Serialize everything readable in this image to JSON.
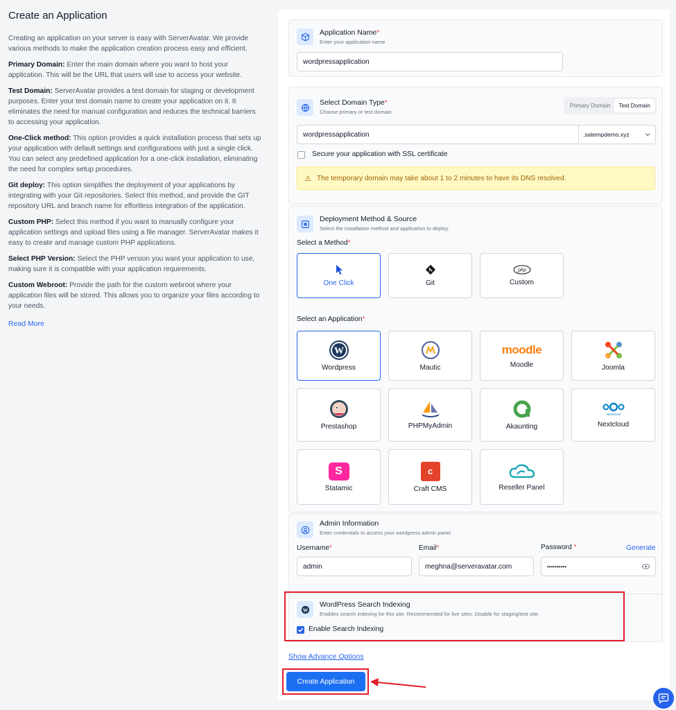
{
  "left": {
    "title": "Create an Application",
    "intro": "Creating an application on your server is easy with ServerAvatar. We provide various methods to make the application creation process easy and efficient.",
    "sections": [
      {
        "term": "Primary Domain:",
        "text": " Enter the main domain where you want to host your application. This will be the URL that users will use to access your website."
      },
      {
        "term": "Test Domain:",
        "text": " ServerAvatar provides a test domain for staging or development purposes. Enter your test domain name to create your application on it. It eliminates the need for manual configuration and reduces the technical barriers to accessing your application."
      },
      {
        "term": "One-Click method:",
        "text": " This option provides a quick installation process that sets up your application with default settings and configurations with just a single click. You can select any predefined application for a one-click installation, eliminating the need for complex setup procedures."
      },
      {
        "term": "Git deploy:",
        "text": " This option simplifies the deployment of your applications by integrating with your Git repositories. Select this method, and provide the GIT repository URL and branch name for effortless integration of the application."
      },
      {
        "term": "Custom PHP:",
        "text": " Select this method if you want to manually configure your application settings and upload files using a file manager. ServerAvatar makes it easy to create and manage custom PHP applications."
      },
      {
        "term": "Select PHP Version:",
        "text": " Select the PHP version you want your application to use, making sure it is compatible with your application requirements."
      },
      {
        "term": "Custom Webroot:",
        "text": " Provide the path for the custom webroot where your application files will be stored. This allows you to organize your files according to your needs."
      }
    ],
    "read_more": "Read More"
  },
  "app_name": {
    "title": "Application Name",
    "required": "*",
    "subtitle": "Enter your application name",
    "value": "wordpressapplication"
  },
  "domain": {
    "title": "Select Domain Type",
    "required": "*",
    "subtitle": "Choose primary or test domain",
    "options": [
      "Primary Domain",
      "Test Domain"
    ],
    "selected": "Test Domain",
    "value": "wordpressapplication",
    "suffix": ".satempdemo.xyz",
    "ssl_label": "Secure your application with SSL certificate",
    "alert": "The temporary domain may take about 1 to 2 minutes to have its DNS resolved."
  },
  "deploy": {
    "title": "Deployment Method & Source",
    "subtitle": "Select the installation method and application to deploy.",
    "method_label": "Select a Method",
    "required": "*",
    "methods": [
      {
        "label": "One Click",
        "icon": "cursor-icon",
        "selected": true
      },
      {
        "label": "Git",
        "icon": "git-icon",
        "selected": false
      },
      {
        "label": "Custom",
        "icon": "php-icon",
        "selected": false
      }
    ],
    "app_label": "Select an Application",
    "apps": [
      {
        "label": "Wordpress",
        "icon": "wordpress-icon",
        "selected": true
      },
      {
        "label": "Mautic",
        "icon": "mautic-icon"
      },
      {
        "label": "Moodle",
        "icon": "moodle-logo",
        "logo_text": "moodle"
      },
      {
        "label": "Joomla",
        "icon": "joomla-icon"
      },
      {
        "label": "Prestashop",
        "icon": "prestashop-icon"
      },
      {
        "label": "PHPMyAdmin",
        "icon": "phpmyadmin-icon"
      },
      {
        "label": "Akaunting",
        "icon": "akaunting-icon"
      },
      {
        "label": "Nextcloud",
        "icon": "nextcloud-icon",
        "logo_text": "Nextcloud"
      },
      {
        "label": "Statamic",
        "icon": "statamic-icon",
        "logo_text": "S"
      },
      {
        "label": "Craft CMS",
        "icon": "craft-icon",
        "logo_text": "c"
      },
      {
        "label": "Reseller Panel",
        "icon": "reseller-cloud-icon"
      }
    ]
  },
  "admin": {
    "title": "Admin Information",
    "subtitle": "Enter credentials to access your wordpress admin panel.",
    "username_label": "Username",
    "email_label": "Email",
    "password_label": "Password",
    "required": "*",
    "generate": "Generate",
    "username": "admin",
    "email": "meghna@serveravatar.com",
    "password": "••••••••••"
  },
  "indexing": {
    "title": "WordPress Search Indexing",
    "subtitle": "Enables search indexing for this site. Recommended for live sites. Disable for staging/test site.",
    "checkbox_label": "Enable Search Indexing",
    "checked": true
  },
  "advance_link": "Show Advance Options",
  "create_button": "Create Application",
  "colors": {
    "accent": "#2563eb",
    "highlight": "#e11d2a",
    "alert_bg": "#fef9c3"
  }
}
